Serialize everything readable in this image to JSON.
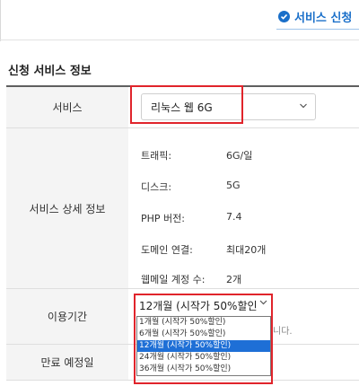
{
  "header": {
    "apply_button": "서비스 신청"
  },
  "section": {
    "title": "신청 서비스 정보"
  },
  "rows": {
    "service": {
      "label": "서비스",
      "selected": "리눅스 웹 6G"
    },
    "detail": {
      "label": "서비스 상세 정보",
      "items": [
        {
          "key": "트래픽:",
          "value": "6G/일"
        },
        {
          "key": "디스크:",
          "value": "5G"
        },
        {
          "key": "PHP 버전:",
          "value": "7.4"
        },
        {
          "key": "도메인 연결:",
          "value": "최대20개"
        },
        {
          "key": "웹메일 계정 수:",
          "value": "2개"
        }
      ]
    },
    "period": {
      "label": "이용기간",
      "selected": "12개월 (시작가 50%할인",
      "note": "니다.",
      "options": [
        "1개월 (시작가 50%할인)",
        "6개월 (시작가 50%할인)",
        "12개월 (시작가 50%할인)",
        "24개월 (시작가 50%할인)",
        "36개월 (시작가 50%할인)"
      ],
      "selected_index": 2
    },
    "expiry": {
      "label": "만료 예정일"
    }
  },
  "colors": {
    "accent": "#1a6fc9",
    "highlight_border": "#e0242b",
    "selected_option": "#1e6fd6"
  }
}
